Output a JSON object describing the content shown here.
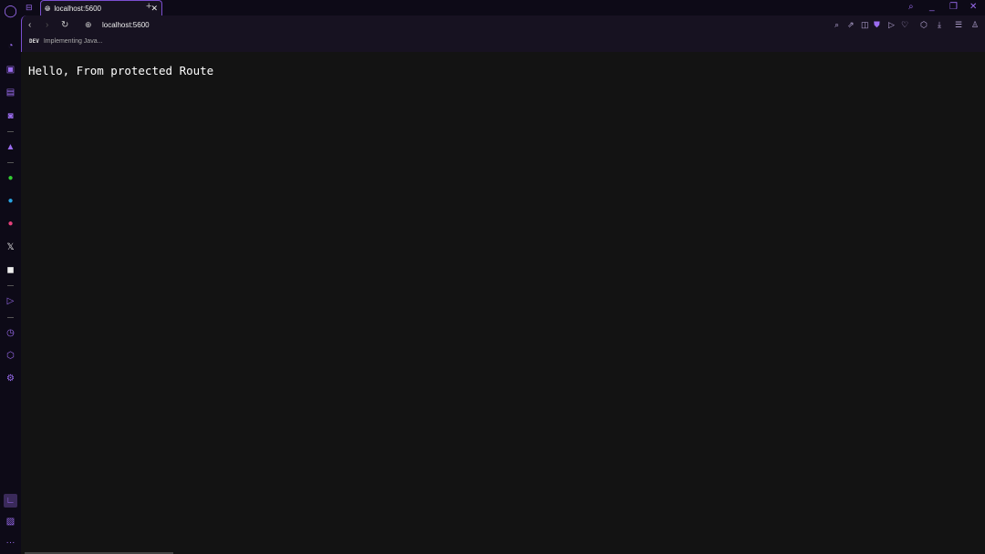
{
  "tab": {
    "title": "localhost:5600"
  },
  "address": {
    "url": "localhost:5600"
  },
  "bookmarks": [
    {
      "badge": "DEV",
      "label": "Implementing Java..."
    }
  ],
  "page": {
    "heading": "Hello, From protected Route"
  },
  "sidebar_icons": [
    "opera-logo-icon",
    "speed-dial-icon",
    "shopping-icon",
    "twitch-icon",
    "instagram-app-icon",
    "aria-icon",
    "whatsapp-icon",
    "telegram-icon",
    "instagram-icon",
    "x-icon",
    "discord-icon",
    "player-icon",
    "history-icon",
    "extensions-icon",
    "settings-icon",
    "gx-corner-icon",
    "snapshot-icon",
    "more-icon"
  ],
  "colors": {
    "accent": "#7b4fd0",
    "background": "#131313"
  }
}
